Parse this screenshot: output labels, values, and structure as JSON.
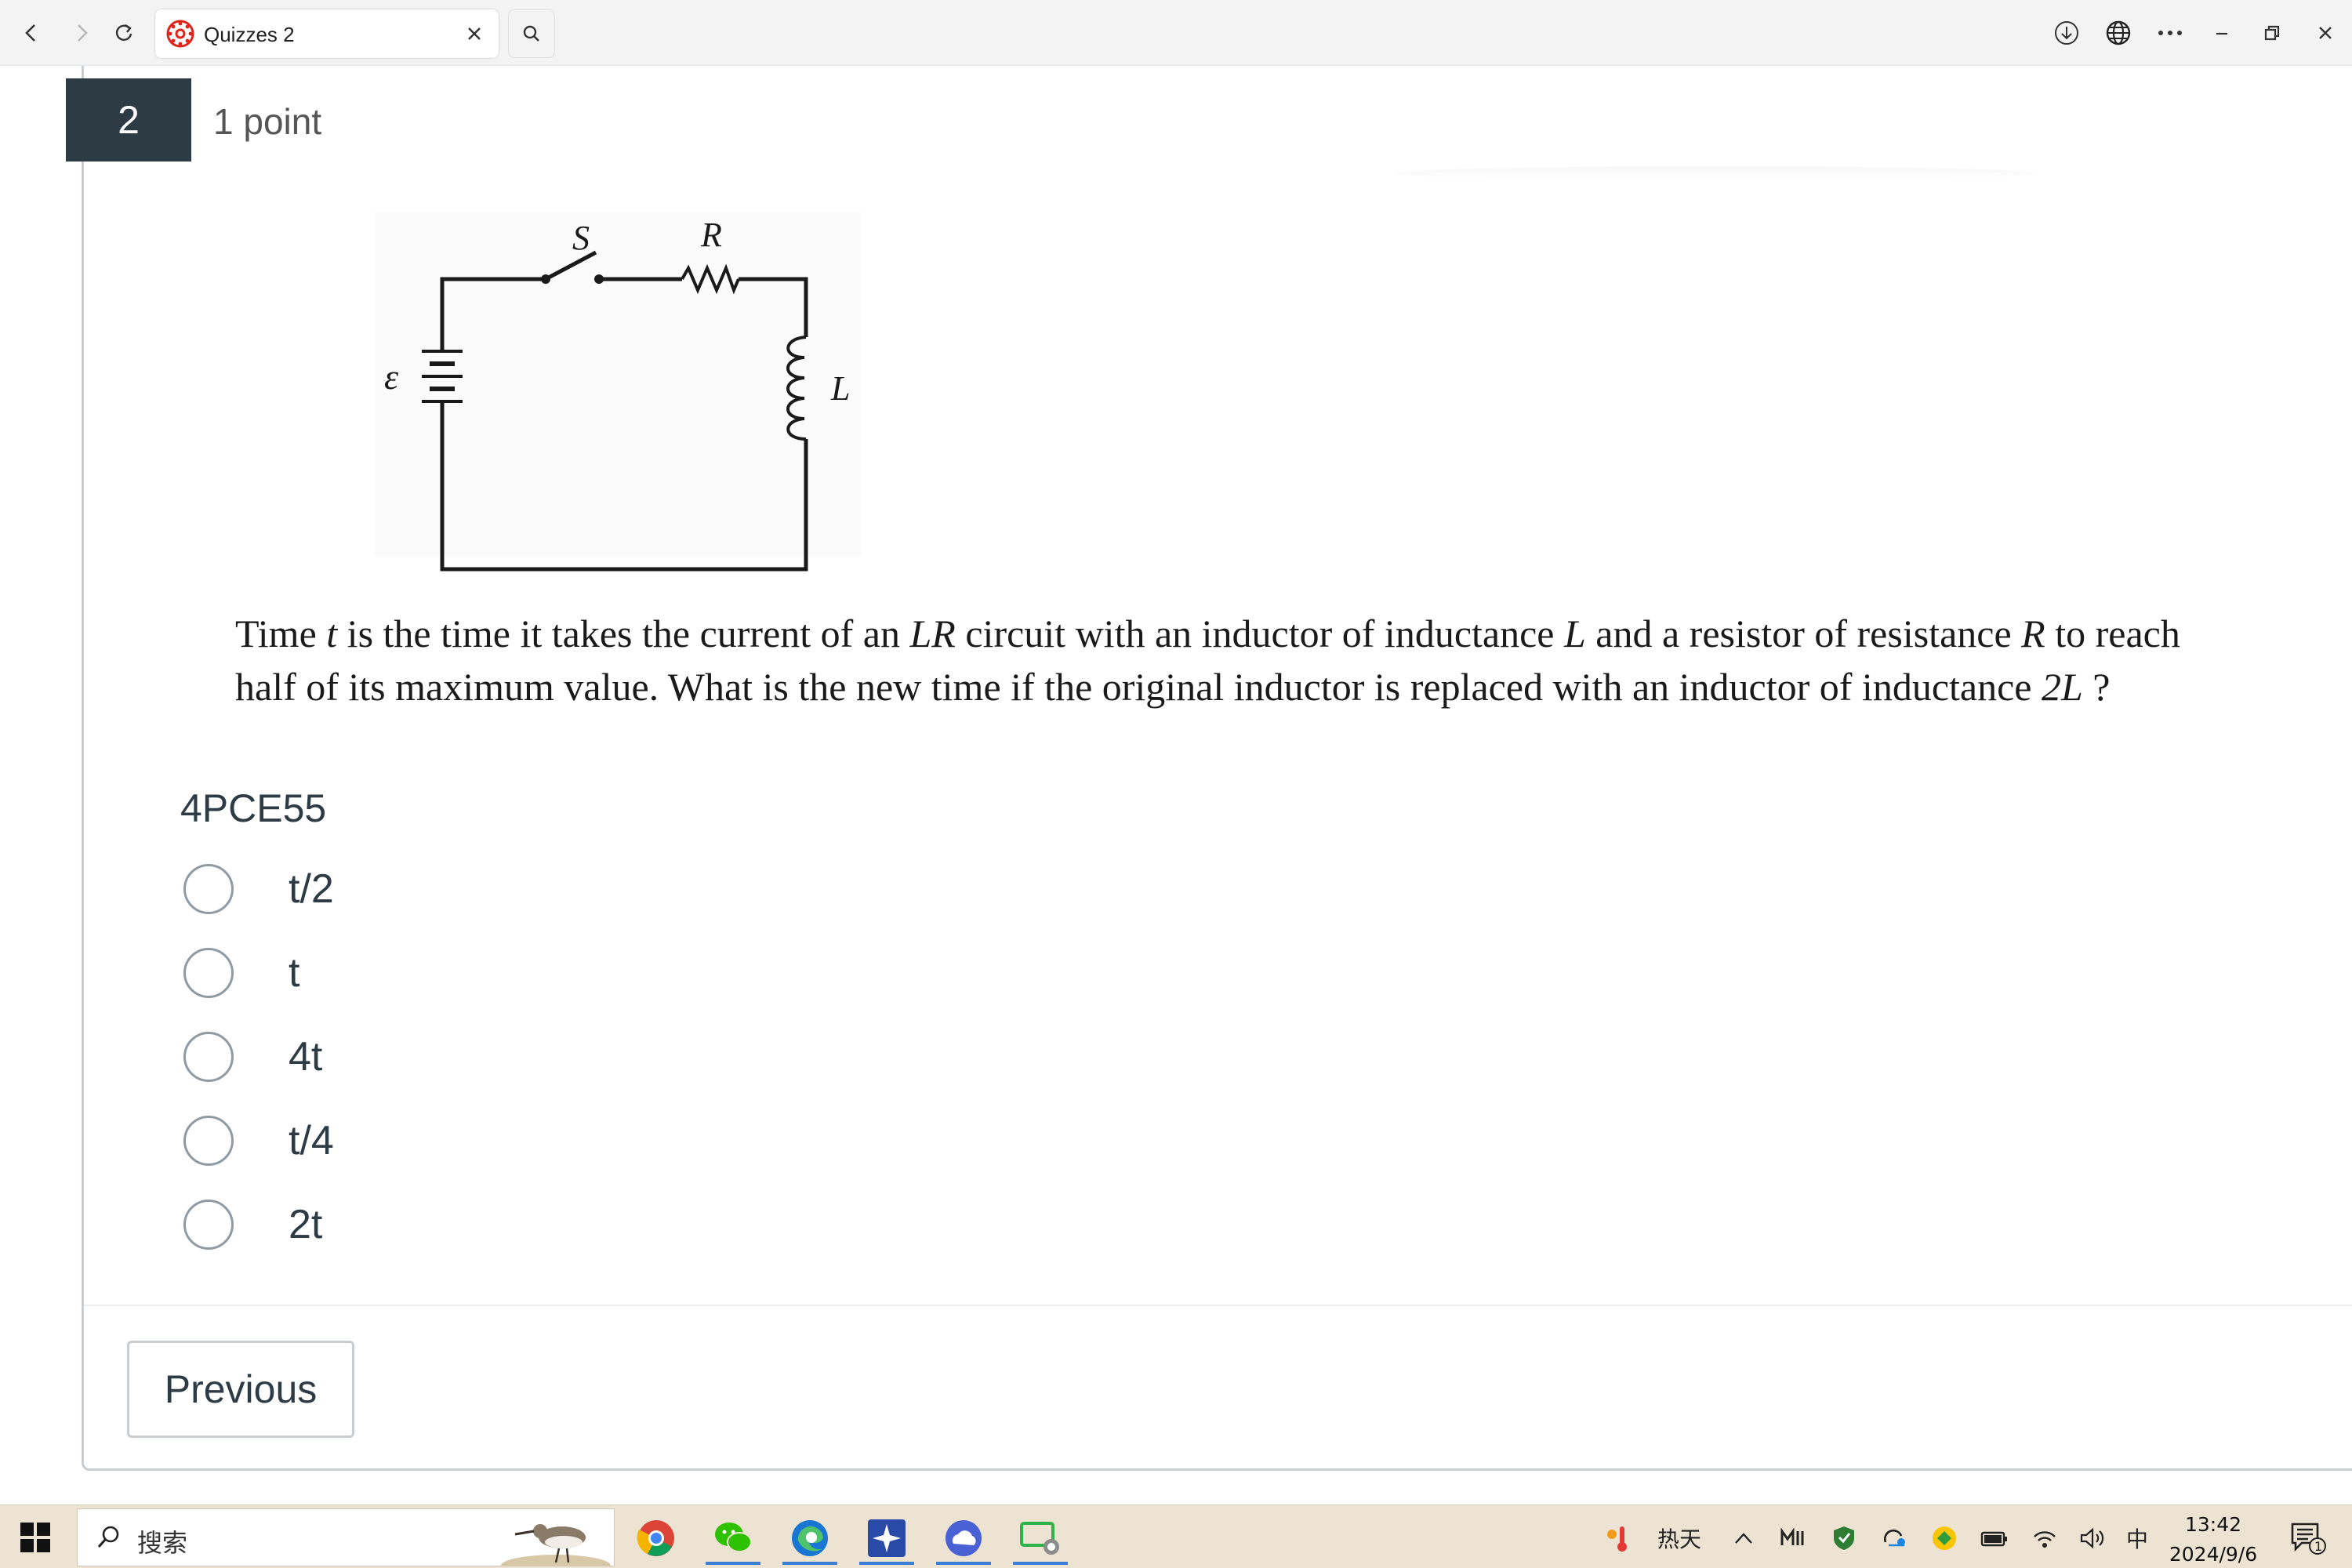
{
  "browser": {
    "tab_title": "Quizzes 2",
    "icons": [
      "back-icon",
      "forward-icon",
      "refresh-icon",
      "close-icon",
      "search-icon",
      "download-icon",
      "globe-icon",
      "more-icon",
      "minimize-icon",
      "restore-icon",
      "window-close-icon"
    ]
  },
  "question": {
    "number": "2",
    "points": "1 point",
    "text_parts": {
      "p1": "Time ",
      "t": "t",
      "p2": " is the time it takes the current of an ",
      "lr": "LR",
      "p3": " circuit with an inductor of inductance ",
      "l": "L",
      "p4": " and a resistor of resistance ",
      "r": "R",
      "p5": " to reach half of its maximum value. What is the new time if the original inductor is replaced with an inductor of inductance ",
      "two_l": "2L",
      "p6": " ?"
    },
    "code": "4PCE55",
    "circuit_labels": {
      "switch": "S",
      "resistor": "R",
      "emf": "ε",
      "inductor": "L"
    },
    "answers": [
      "t/2",
      "t",
      "4t",
      "t/4",
      "2t"
    ]
  },
  "footer": {
    "previous_label": "Previous"
  },
  "taskbar": {
    "search_label": "搜索",
    "weather": "热天",
    "ime": "中",
    "time": "13:42",
    "date": "2024/9/6",
    "notification_count": "1"
  },
  "colors": {
    "question_badge": "#2d3b45",
    "accent": "#3c7fd4",
    "taskbar": "#ece3d2"
  }
}
